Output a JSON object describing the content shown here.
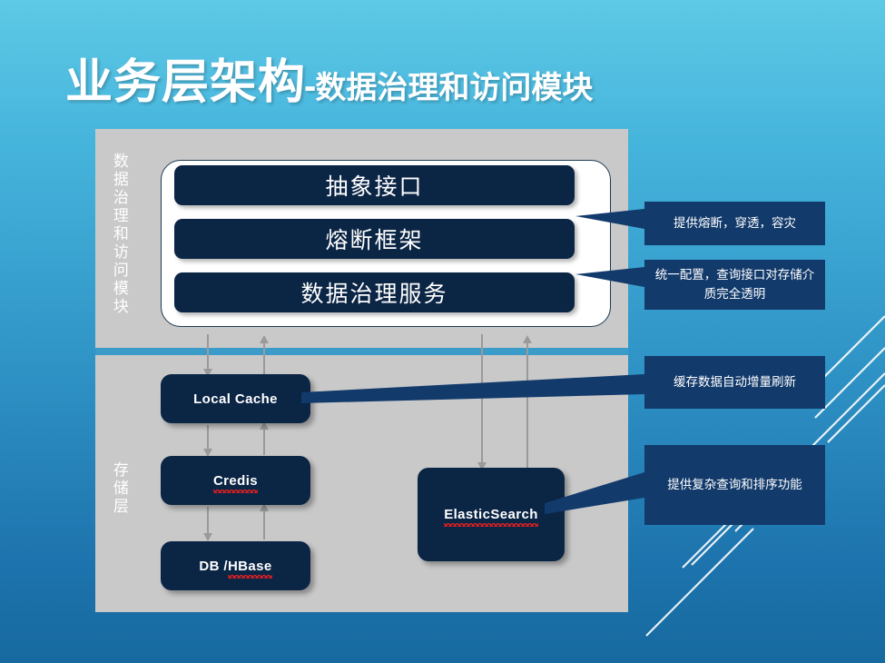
{
  "slide": {
    "title": {
      "main": "业务层架构",
      "dash": "-",
      "sub": "数据治理和访问模块"
    },
    "background": {
      "gradient_top": "#5ec9e6",
      "gradient_bottom": "#166a9f"
    }
  },
  "layers": {
    "governance": {
      "side_label": "数据治理和访问模块",
      "panel_color": "#c9c9c9",
      "boxes": [
        {
          "label": "抽象接口"
        },
        {
          "label": "熔断框架"
        },
        {
          "label": "数据治理服务"
        }
      ]
    },
    "storage": {
      "side_label": "存储层",
      "panel_color": "#c9c9c9",
      "boxes": [
        {
          "label": "Local Cache",
          "misspelled": false
        },
        {
          "label": "Credis",
          "misspelled": true
        },
        {
          "label": "DB / ",
          "label_suffix": "HBase",
          "misspelled": true
        },
        {
          "label": "ElasticSearch",
          "misspelled": true
        }
      ]
    }
  },
  "callouts": [
    {
      "text": "提供熔断，穿透，容灾",
      "target": "熔断框架"
    },
    {
      "text": "统一配置，查询接口对存储介质完全透明",
      "target": "数据治理服务"
    },
    {
      "text": "缓存数据自动增量刷新",
      "target": "Local Cache"
    },
    {
      "text": "提供复杂查询和排序功能",
      "target": "ElasticSearch"
    }
  ],
  "colors": {
    "box_fill": "#0b2545",
    "callout_fill": "#123a6b",
    "divider": "#3b9cc9",
    "arrow": "#9a9a9a",
    "spellcheck_underline": "#e02020"
  }
}
